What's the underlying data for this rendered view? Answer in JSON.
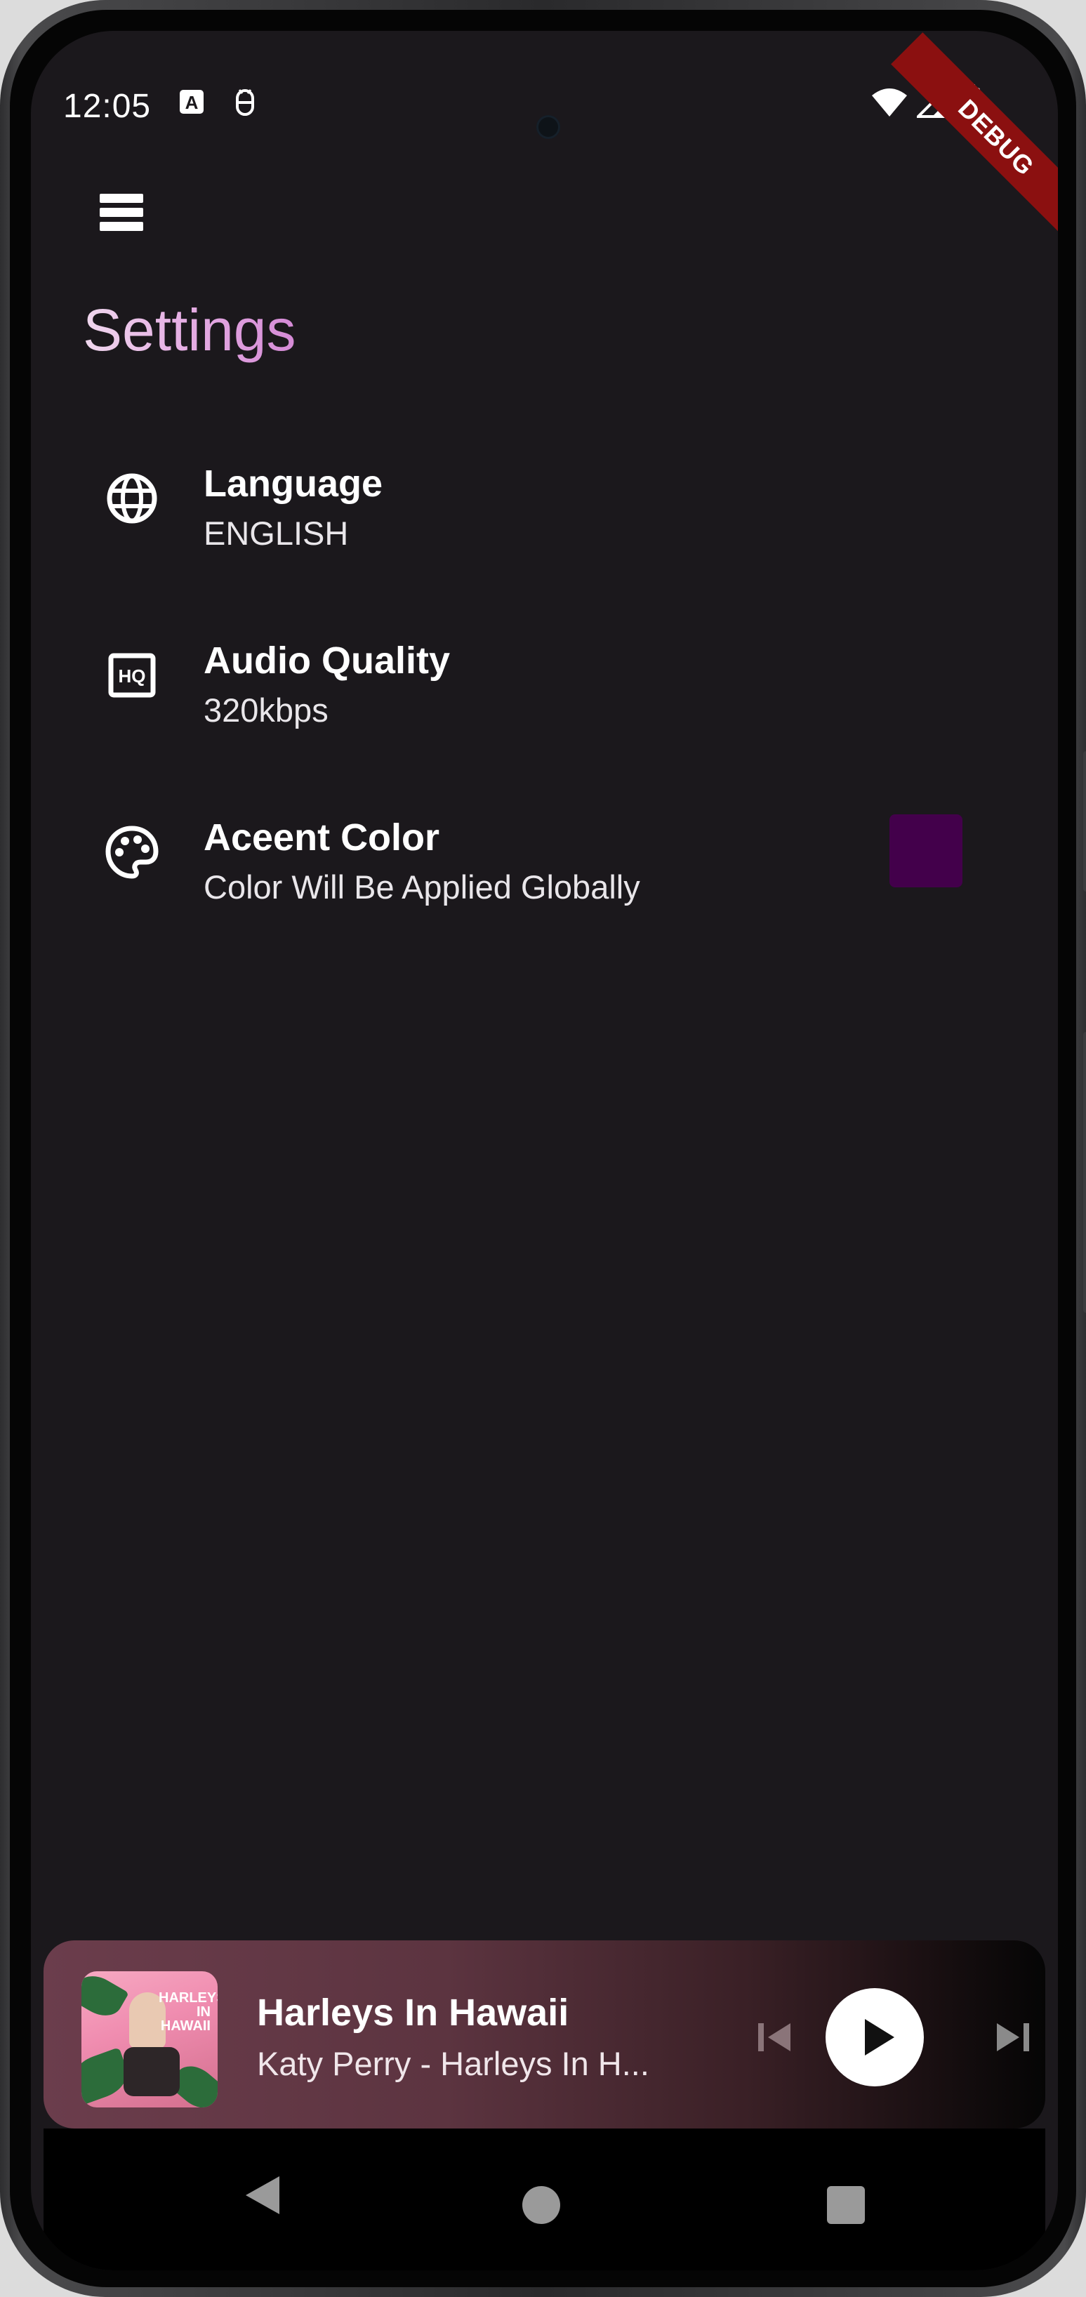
{
  "status_bar": {
    "time": "12:05",
    "icons": [
      "keyboard-a-icon",
      "android-debug-icon",
      "wifi-icon",
      "signal-icon",
      "battery-icon"
    ]
  },
  "debug_banner": "DEBUG",
  "app_bar": {
    "menu_icon": "menu-icon"
  },
  "page": {
    "title": "Settings"
  },
  "settings": [
    {
      "icon": "globe-icon",
      "title": "Language",
      "subtitle": "ENGLISH"
    },
    {
      "icon": "hq-icon",
      "title": "Audio Quality",
      "subtitle": "320kbps"
    },
    {
      "icon": "palette-icon",
      "title": "Aceent Color",
      "subtitle": "Color Will Be Applied Globally",
      "swatch_color": "#43004b"
    }
  ],
  "mini_player": {
    "album_art_text": "HARLEYS IN HAWAII",
    "song_title": "Harleys In Hawaii",
    "artist_line": "Katy Perry - Harleys In H...",
    "controls": [
      "skip-previous-icon",
      "play-icon",
      "skip-next-icon"
    ]
  },
  "nav_bar": {
    "buttons": [
      "back-icon",
      "home-icon",
      "recents-icon"
    ]
  },
  "colors": {
    "background": "#1b181c",
    "accent": "#43004b",
    "title_gradient_end": "#d58ad6"
  }
}
